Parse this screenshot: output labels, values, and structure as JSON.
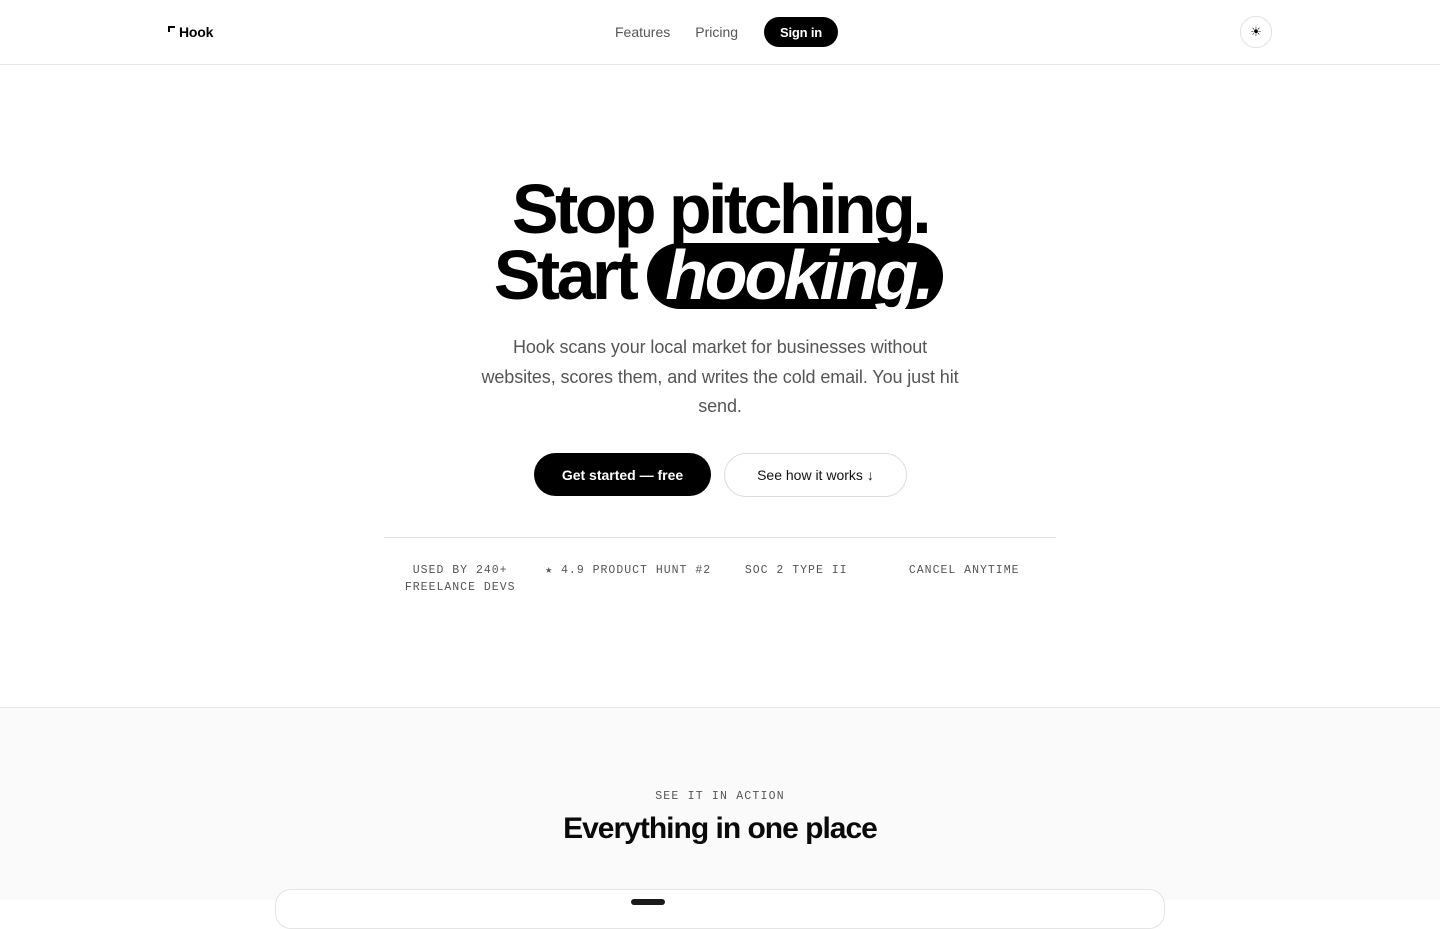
{
  "nav": {
    "logo": "Hook",
    "links": [
      "Features",
      "Pricing"
    ],
    "signin": "Sign in",
    "theme_icon": "☀"
  },
  "hero": {
    "line1": "Stop pitching.",
    "line2_plain": "Start",
    "line2_pill": "hooking.",
    "subtitle": "Hook scans your local market for businesses without websites, scores them, and writes the cold email. You just hit send.",
    "cta_primary": "Get started — free",
    "cta_secondary": "See how it works",
    "cta_secondary_icon": "↓"
  },
  "proof": [
    "Used by 240+ freelance devs",
    "★ 4.9 Product Hunt #2",
    "SOC 2 Type II",
    "Cancel anytime"
  ],
  "section": {
    "eyebrow": "SEE IT IN ACTION",
    "title": "Everything in one place"
  },
  "colors": {
    "accent": "#000000",
    "muted_text": "#555555",
    "border": "#e6e6e6",
    "section_bg": "#fafafa"
  }
}
